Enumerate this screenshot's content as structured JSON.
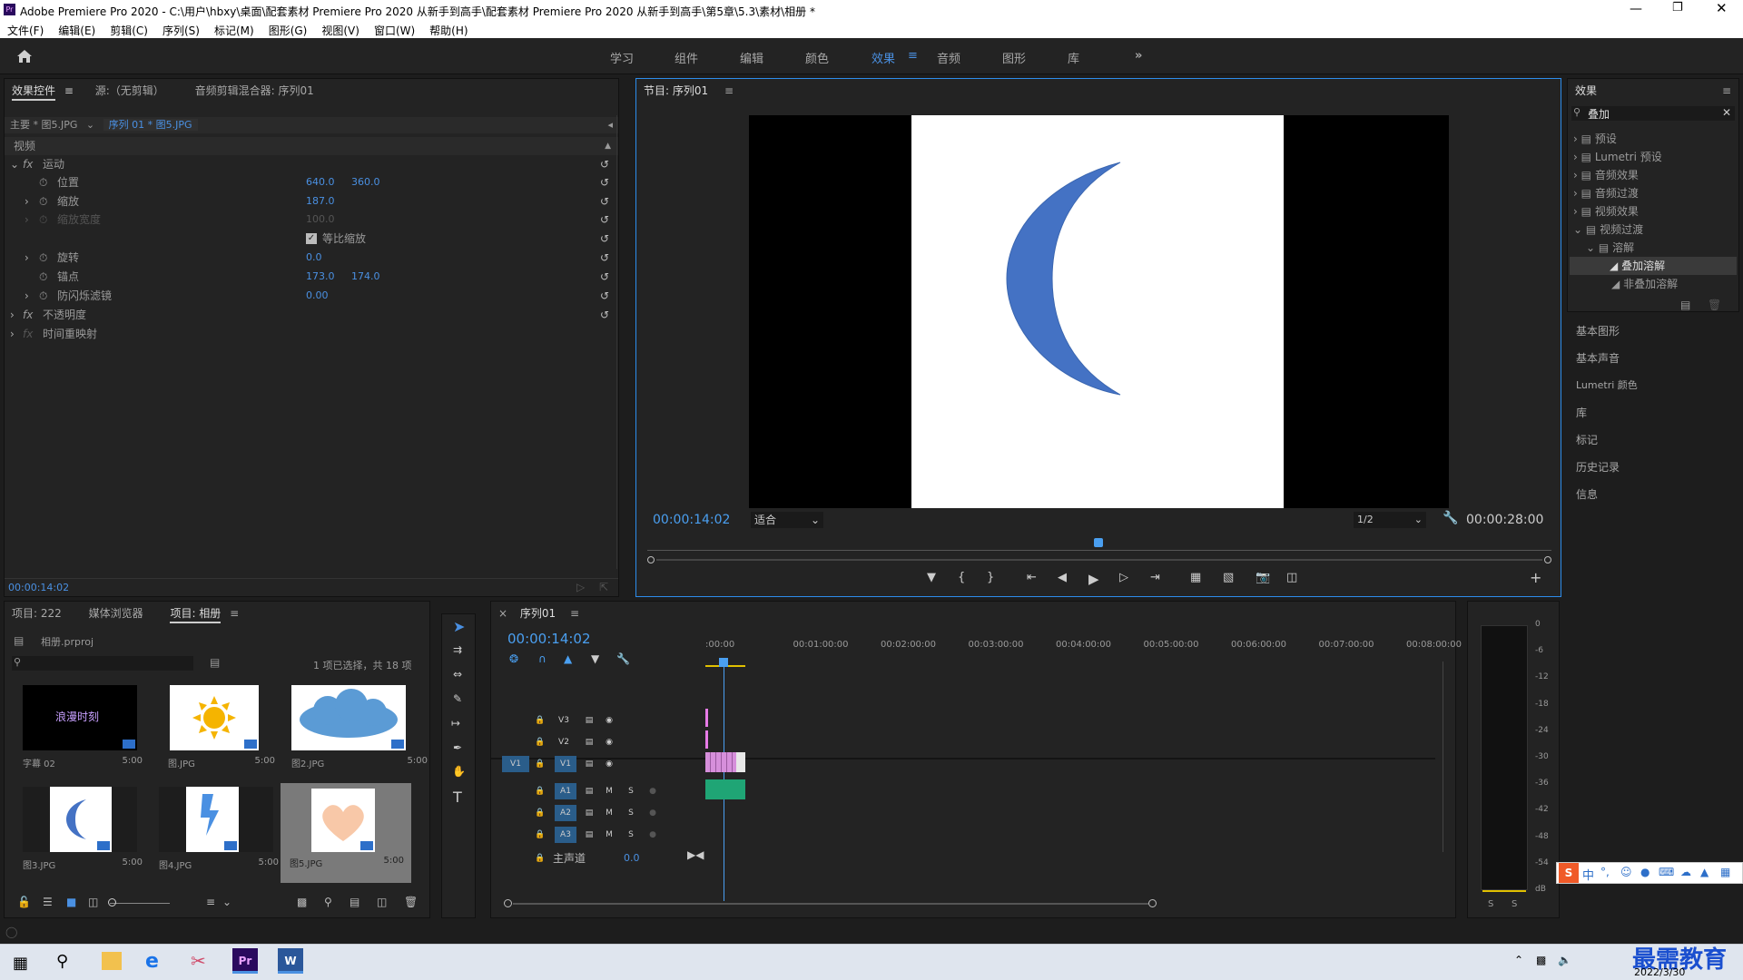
{
  "window": {
    "title": "Adobe Premiere Pro 2020 - C:\\用户\\hbxy\\桌面\\配套素材 Premiere Pro 2020 从新手到高手\\配套素材 Premiere Pro 2020 从新手到高手\\第5章\\5.3\\素材\\相册 *"
  },
  "menu": [
    "文件(F)",
    "编辑(E)",
    "剪辑(C)",
    "序列(S)",
    "标记(M)",
    "图形(G)",
    "视图(V)",
    "窗口(W)",
    "帮助(H)"
  ],
  "workspaces": [
    "学习",
    "组件",
    "编辑",
    "颜色",
    "效果",
    "音频",
    "图形",
    "库"
  ],
  "effect_controls": {
    "tabs": [
      "效果控件",
      "源:（无剪辑）",
      "音频剪辑混合器: 序列01"
    ],
    "master": "主要 * 图5.JPG",
    "sequence": "序列 01 * 图5.JPG",
    "video_label": "视频",
    "motion": "运动",
    "position_label": "位置",
    "position_x": "640.0",
    "position_y": "360.0",
    "scale_label": "缩放",
    "scale": "187.0",
    "scale_width_label": "缩放宽度",
    "scale_width": "100.0",
    "uniform_label": "等比缩放",
    "rotation_label": "旋转",
    "rotation": "0.0",
    "anchor_label": "锚点",
    "anchor_x": "173.0",
    "anchor_y": "174.0",
    "flicker_label": "防闪烁滤镜",
    "flicker": "0.00",
    "opacity": "不透明度",
    "time_remap": "时间重映射",
    "timecode": "00:00:14:02"
  },
  "program": {
    "title": "节目: 序列01",
    "timecode": "00:00:14:02",
    "fit": "适合",
    "quality": "1/2",
    "duration": "00:00:28:00",
    "moon_color": "#4472c4"
  },
  "project": {
    "tabs": [
      "项目: 222",
      "媒体浏览器",
      "项目: 相册"
    ],
    "file": "相册.prproj",
    "status": "1 项已选择，共 18 项",
    "items": [
      {
        "name": "字幕 02",
        "dur": "5:00",
        "caption": "浪漫时刻"
      },
      {
        "name": "图.JPG",
        "dur": "5:00"
      },
      {
        "name": "图2.JPG",
        "dur": "5:00"
      },
      {
        "name": "图3.JPG",
        "dur": "5:00"
      },
      {
        "name": "图4.JPG",
        "dur": "5:00"
      },
      {
        "name": "图5.JPG",
        "dur": "5:00"
      }
    ]
  },
  "timeline": {
    "tab": "序列01",
    "timecode": "00:00:14:02",
    "ruler": [
      ":00:00",
      "00:01:00:00",
      "00:02:00:00",
      "00:03:00:00",
      "00:04:00:00",
      "00:05:00:00",
      "00:06:00:00",
      "00:07:00:00",
      "00:08:00:00"
    ],
    "video_tracks": [
      "V3",
      "V2",
      "V1"
    ],
    "audio_tracks": [
      "A1",
      "A2",
      "A3"
    ],
    "src_v": "V1",
    "master_label": "主声道",
    "master_value": "0.0",
    "m": "M",
    "s": "S"
  },
  "effects": {
    "title": "效果",
    "search": "叠加",
    "tree": [
      "预设",
      "Lumetri 预设",
      "音频效果",
      "音频过渡",
      "视频效果",
      "视频过渡",
      "溶解",
      "叠加溶解",
      "非叠加溶解"
    ],
    "panels": [
      "基本图形",
      "基本声音",
      "Lumetri 颜色",
      "库",
      "标记",
      "历史记录",
      "信息"
    ]
  },
  "meter": {
    "ticks": [
      "0",
      "-6",
      "-12",
      "-18",
      "-24",
      "-30",
      "-36",
      "-42",
      "-48",
      "-54",
      "dB"
    ],
    "s": "S"
  },
  "taskbar": {
    "date": "2022/3/30",
    "watermark": "最需教育",
    "ime": "中"
  }
}
